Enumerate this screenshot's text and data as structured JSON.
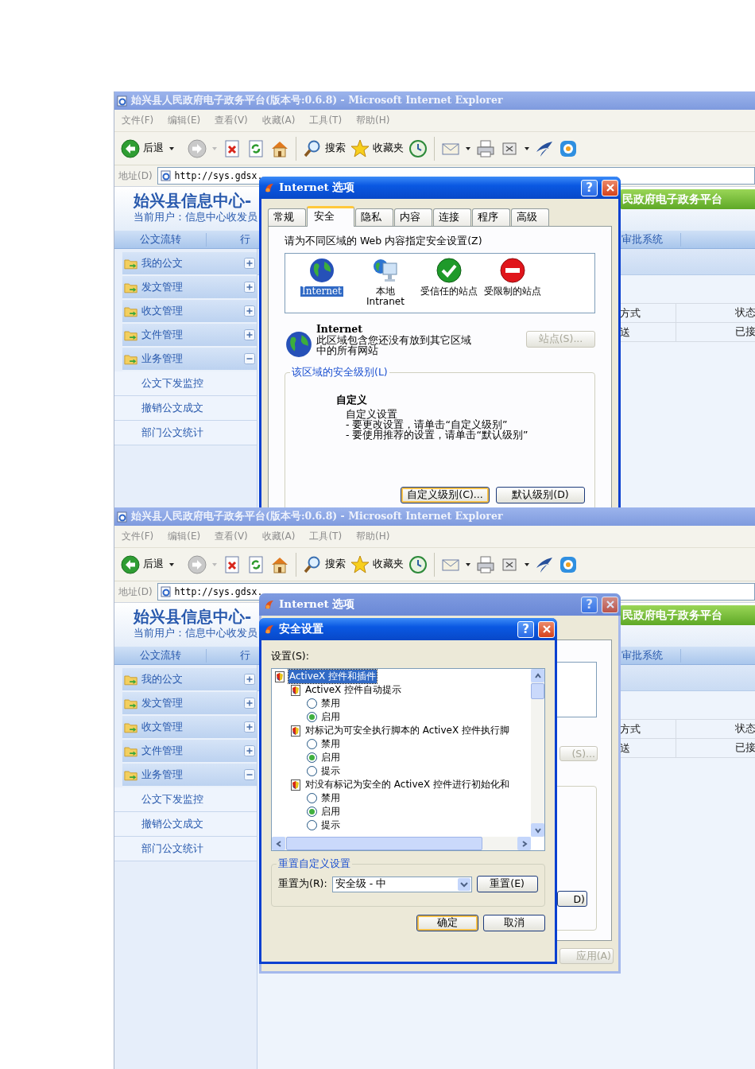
{
  "shots": [
    {
      "window": {
        "title": "始兴县人民政府电子政务平台(版本号:0.6.8) - Microsoft Internet Explorer"
      },
      "menu": [
        "文件(F)",
        "编辑(E)",
        "查看(V)",
        "收藏(A)",
        "工具(T)",
        "帮助(H)"
      ],
      "toolbar": {
        "back": "后退",
        "search": "搜索",
        "favorites": "收藏夹"
      },
      "address": {
        "label": "地址(D)",
        "url": "http://sys.gdsx."
      },
      "page": {
        "title": "始兴县信息中心-",
        "user": "当前用户：信息中心收发员",
        "banner": "民政府电子政务平台",
        "nav_left": [
          "公文流转",
          "行"
        ],
        "nav_right": [
          "审批系统"
        ],
        "sidebar": [
          {
            "label": "我的公文",
            "expanded": false
          },
          {
            "label": "发文管理",
            "expanded": false
          },
          {
            "label": "收文管理",
            "expanded": false
          },
          {
            "label": "文件管理",
            "expanded": false
          },
          {
            "label": "业务管理",
            "expanded": true,
            "children": [
              "公文下发监控",
              "撤销公文成文",
              "部门公文统计"
            ]
          }
        ],
        "table": {
          "columns": [
            "方式",
            "状态"
          ],
          "rows": [
            [
              "送",
              "已接"
            ]
          ]
        }
      },
      "dialogs": [
        {
          "kind": "internet_options",
          "title": "Internet 选项",
          "active": true,
          "help": "?",
          "tabs": [
            {
              "label": "常规",
              "selected": false
            },
            {
              "label": "安全",
              "selected": true
            },
            {
              "label": "隐私",
              "selected": false
            },
            {
              "label": "内容",
              "selected": false
            },
            {
              "label": "连接",
              "selected": false
            },
            {
              "label": "程序",
              "selected": false
            },
            {
              "label": "高级",
              "selected": false
            }
          ],
          "prompt": "请为不同区域的 Web 内容指定安全设置(Z)",
          "zones": [
            {
              "kind": "internet",
              "label": "Internet",
              "selected": true
            },
            {
              "kind": "intranet",
              "label": "本地 Intranet",
              "selected": false
            },
            {
              "kind": "trusted",
              "label": "受信任的站点",
              "selected": false
            },
            {
              "kind": "restricted",
              "label": "受限制的站点",
              "selected": false
            }
          ],
          "zone_name": "Internet",
          "zone_description": "此区域包含您还没有放到其它区域中的所有网站",
          "sites_button": {
            "label": "站点(S)...",
            "disabled": true
          },
          "level_group": "该区域的安全级别(L)",
          "level_name": "自定义",
          "level_lines": [
            "自定义设置",
            "- 要更改设置，请单击“自定义级别”",
            "- 要使用推荐的设置，请单击“默认级别”"
          ],
          "buttons": [
            {
              "label": "自定义级别(C)...",
              "default": true
            },
            {
              "label": "默认级别(D)",
              "default": false
            }
          ]
        }
      ]
    },
    {
      "window": {
        "title": "始兴县人民政府电子政务平台(版本号:0.6.8) - Microsoft Internet Explorer"
      },
      "menu": [
        "文件(F)",
        "编辑(E)",
        "查看(V)",
        "收藏(A)",
        "工具(T)",
        "帮助(H)"
      ],
      "toolbar": {
        "back": "后退",
        "search": "搜索",
        "favorites": "收藏夹"
      },
      "address": {
        "label": "地址(D)",
        "url": "http://sys.gdsx."
      },
      "page": {
        "title": "始兴县信息中心-",
        "user": "当前用户：信息中心收发员",
        "banner": "民政府电子政务平台",
        "nav_left": [
          "公文流转",
          "行"
        ],
        "nav_right": [
          "审批系统"
        ],
        "sidebar": [
          {
            "label": "我的公文",
            "expanded": false
          },
          {
            "label": "发文管理",
            "expanded": false
          },
          {
            "label": "收文管理",
            "expanded": false
          },
          {
            "label": "文件管理",
            "expanded": false
          },
          {
            "label": "业务管理",
            "expanded": true,
            "children": [
              "公文下发监控",
              "撤销公文成文",
              "部门公文统计"
            ]
          }
        ],
        "table": {
          "columns": [
            "方式",
            "状态"
          ],
          "rows": [
            [
              "送",
              "已接"
            ]
          ]
        }
      },
      "dialogs": [
        {
          "kind": "internet_options_covered",
          "title": "Internet 选项",
          "active": false,
          "help": "?",
          "sites_button": {
            "label": "(S)...",
            "disabled": true
          },
          "default_button": "D)",
          "apply_button": {
            "label": "应用(A)",
            "disabled": true
          }
        },
        {
          "kind": "security_settings",
          "title": "安全设置",
          "active": true,
          "help": "?",
          "settings_label": "设置(S):",
          "tree": [
            {
              "label": "ActiveX 控件和插件",
              "selected": true,
              "children": [
                {
                  "label": "ActiveX 控件自动提示",
                  "selected": false,
                  "children": [
                    {
                      "label": "禁用",
                      "selected": false
                    },
                    {
                      "label": "启用",
                      "selected": true
                    }
                  ]
                },
                {
                  "label": "对标记为可安全执行脚本的 ActiveX 控件执行脚",
                  "selected": false,
                  "children": [
                    {
                      "label": "禁用",
                      "selected": false
                    },
                    {
                      "label": "启用",
                      "selected": true
                    },
                    {
                      "label": "提示",
                      "selected": false
                    }
                  ]
                },
                {
                  "label": "对没有标记为安全的 ActiveX 控件进行初始化和",
                  "selected": false,
                  "children": [
                    {
                      "label": "禁用",
                      "selected": false
                    },
                    {
                      "label": "启用",
                      "selected": true
                    },
                    {
                      "label": "提示",
                      "selected": false
                    }
                  ]
                }
              ]
            }
          ],
          "reset_group": "重置自定义设置",
          "reset_label": "重置为(R):",
          "reset_value": "安全级 - 中",
          "reset_button": "重置(E)",
          "buttons": [
            {
              "label": "确定",
              "default": true
            },
            {
              "label": "取消",
              "default": false
            }
          ]
        }
      ]
    }
  ]
}
